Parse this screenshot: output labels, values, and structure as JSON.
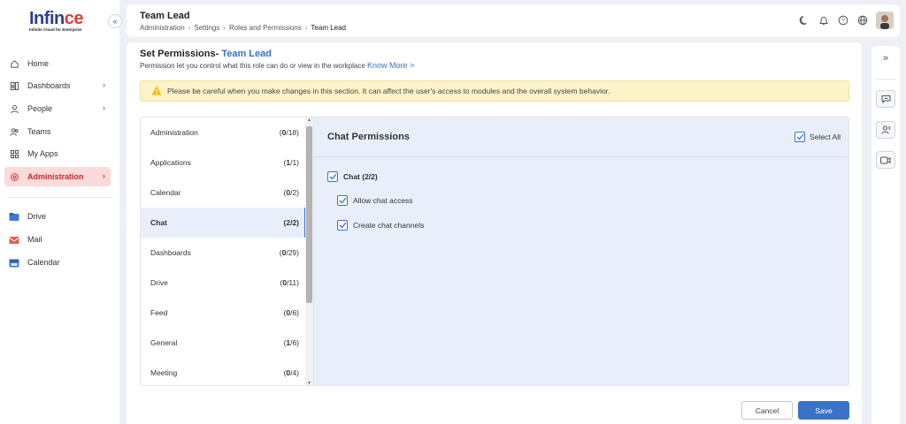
{
  "brand": {
    "logo_prefix": "Inf",
    "logo_mid": "in",
    "logo_o": "ce",
    "tagline": "Infinite Cloud for Enterprise",
    "accent": "#e53935",
    "primary": "#2d3e8c"
  },
  "sidebar": {
    "collapse_icon": "double-chevron-left-icon",
    "items": [
      {
        "label": "Home",
        "icon": "home-icon"
      },
      {
        "label": "Dashboards",
        "icon": "dashboard-icon",
        "has_children": true
      },
      {
        "label": "People",
        "icon": "person-icon",
        "has_children": true
      },
      {
        "label": "Teams",
        "icon": "teams-icon"
      },
      {
        "label": "My Apps",
        "icon": "apps-icon"
      },
      {
        "label": "Administration",
        "icon": "admin-gear-icon",
        "has_children": true,
        "active": true
      },
      {
        "label": "Drive",
        "icon": "drive-icon"
      },
      {
        "label": "Mail",
        "icon": "mail-icon"
      },
      {
        "label": "Calendar",
        "icon": "calendar-icon"
      }
    ]
  },
  "header": {
    "title": "Team Lead",
    "breadcrumb": [
      "Administration",
      "Settings",
      "Roles and Permissions",
      "Team Lead"
    ],
    "icons": [
      "moon-icon",
      "bell-icon",
      "help-icon",
      "globe-icon",
      "avatar"
    ]
  },
  "permissions": {
    "title_prefix": "Set Permissions-",
    "role": "Team Lead",
    "subtitle": "Permission let you control what this role can do or view in the workplace",
    "know_more": "Know More >",
    "warning": "Please be careful when you make changes in this section. It can affect the user's access to modules and the overall system behavior.",
    "categories": [
      {
        "label": "Administration",
        "granted": "0",
        "total": "/18)"
      },
      {
        "label": "Applications",
        "granted": "1",
        "total": "/1)"
      },
      {
        "label": "Calendar",
        "granted": "0",
        "total": "/2)"
      },
      {
        "label": "Chat",
        "granted": "2",
        "total": "/2)",
        "active": true
      },
      {
        "label": "Dashboards",
        "granted": "0",
        "total": "/29)"
      },
      {
        "label": "Drive",
        "granted": "0",
        "total": "/11)"
      },
      {
        "label": "Feed",
        "granted": "0",
        "total": "/6)"
      },
      {
        "label": "General",
        "granted": "1",
        "total": "/6)"
      },
      {
        "label": "Meeting",
        "granted": "0",
        "total": "/4)"
      }
    ],
    "detail": {
      "title": "Chat Permissions",
      "select_all": "Select All",
      "group": "Chat (2/2)",
      "items": [
        "Allow chat access",
        "Create chat channels"
      ]
    }
  },
  "actions": {
    "cancel": "Cancel",
    "save": "Save"
  },
  "rail": {
    "expand_icon": "double-chevron-right-icon",
    "icons": [
      "chat-bubble-icon",
      "contacts-icon",
      "video-icon"
    ]
  }
}
